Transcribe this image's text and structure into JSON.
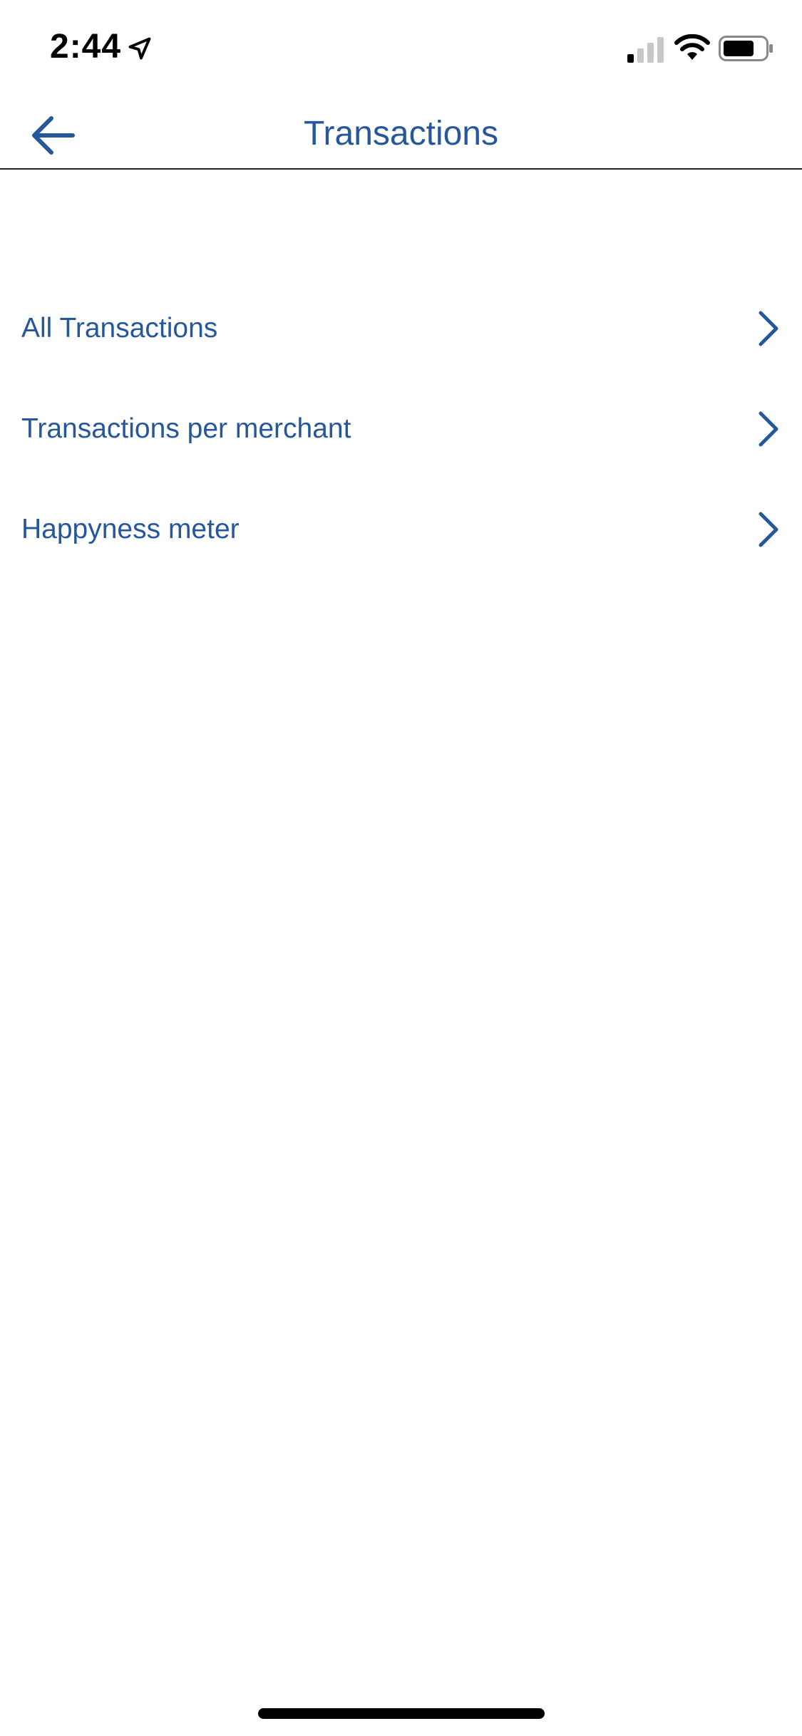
{
  "status_bar": {
    "time": "2:44"
  },
  "nav": {
    "title": "Transactions"
  },
  "menu": {
    "items": [
      {
        "label": "All Transactions"
      },
      {
        "label": "Transactions per merchant"
      },
      {
        "label": "Happyness meter"
      }
    ]
  },
  "colors": {
    "accent": "#27579b"
  }
}
